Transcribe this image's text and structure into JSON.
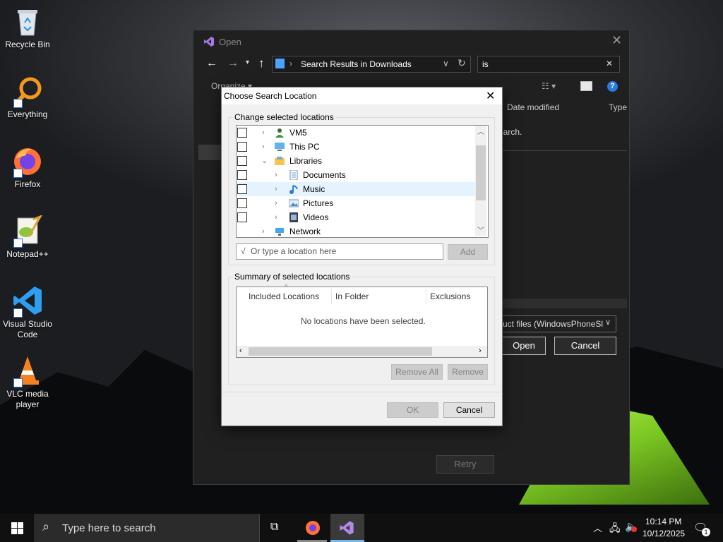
{
  "desktop": {
    "icons": [
      {
        "label": "Recycle Bin"
      },
      {
        "label": "Everything"
      },
      {
        "label": "Firefox"
      },
      {
        "label": "Notepad++"
      },
      {
        "label": "Visual Studio Code"
      },
      {
        "label": "VLC media player"
      }
    ]
  },
  "open_dialog": {
    "title": "Open",
    "address": "Search Results in Downloads",
    "search_value": "is",
    "toolbar": {
      "organize": "Organize ▾"
    },
    "columns": [
      "Date modified",
      "Type"
    ],
    "search_msg": "earch.",
    "file_type": "uct files (WindowsPhoneSl",
    "open_label": "Open",
    "cancel_label": "Cancel",
    "retry_label": "Retry"
  },
  "csl_dialog": {
    "title": "Choose Search Location",
    "change_group_label": "Change selected locations",
    "tree_items": [
      {
        "label": "VM5",
        "icon": "user-icon"
      },
      {
        "label": "This PC",
        "icon": "computer-icon"
      },
      {
        "label": "Libraries",
        "icon": "library-folder-icon"
      },
      {
        "label": "Documents",
        "icon": "documents-icon"
      },
      {
        "label": "Music",
        "icon": "music-icon"
      },
      {
        "label": "Pictures",
        "icon": "pictures-icon"
      },
      {
        "label": "Videos",
        "icon": "videos-icon"
      },
      {
        "label": "Network",
        "icon": "network-icon"
      }
    ],
    "location_input": {
      "prefix": "√",
      "placeholder": "Or type a location here"
    },
    "add_label": "Add",
    "summary_group_label": "Summary of selected locations",
    "summary_columns": [
      "Included Locations",
      "In Folder",
      "Exclusions"
    ],
    "summary_empty": "No locations have been selected.",
    "remove_all_label": "Remove All",
    "remove_label": "Remove",
    "ok_label": "OK",
    "cancel_label": "Cancel"
  },
  "taskbar": {
    "search_placeholder": "Type here to search",
    "time": "10:14 PM",
    "date": "10/12/2025",
    "notification_count": "1"
  }
}
